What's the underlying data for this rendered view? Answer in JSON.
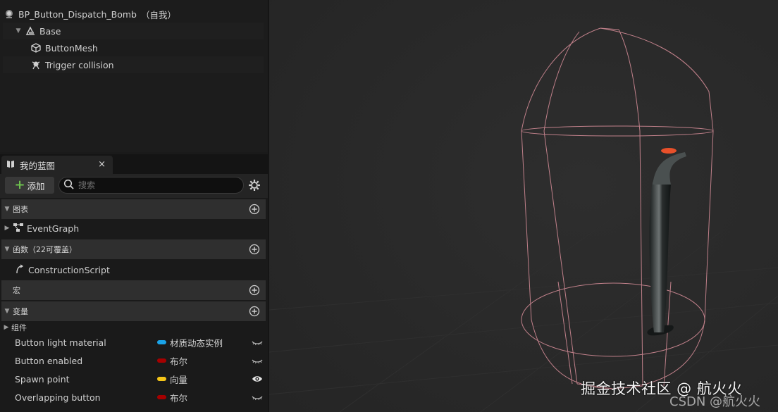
{
  "components": {
    "root_label": "BP_Button_Dispatch_Bomb",
    "root_suffix": "（自我）",
    "items": [
      {
        "label": "Base",
        "icon": "scene-component-icon"
      },
      {
        "label": "ButtonMesh",
        "icon": "static-mesh-icon"
      },
      {
        "label": "Trigger collision",
        "icon": "trigger-icon"
      }
    ]
  },
  "my_blueprint": {
    "tab_label": "我的蓝图",
    "close_glyph": "×",
    "add_label": "添加",
    "search_placeholder": "搜索",
    "sections": {
      "graphs": {
        "label": "图表",
        "items": [
          {
            "label": "EventGraph"
          }
        ]
      },
      "functions": {
        "label": "函数（22可覆盖）",
        "items": [
          {
            "label": "ConstructionScript"
          }
        ]
      },
      "macros": {
        "label": "宏"
      },
      "variables": {
        "label": "变量",
        "group_label": "组件",
        "items": [
          {
            "name": "Button light material",
            "type": "材质动态实例",
            "color": "#1aa3e8",
            "visible": false
          },
          {
            "name": "Button enabled",
            "type": "布尔",
            "color": "#a60000",
            "visible": false
          },
          {
            "name": "Spawn point",
            "type": "向量",
            "color": "#f5c518",
            "visible": true
          },
          {
            "name": "Overlapping button",
            "type": "布尔",
            "color": "#a60000",
            "visible": false
          }
        ]
      }
    }
  },
  "viewport": {
    "watermark": "掘金技术社区 @ 航火火",
    "watermark_sub": "CSDN @航火火",
    "wireframe_color": "#c0808a",
    "button_light_color": "#e8502a"
  }
}
